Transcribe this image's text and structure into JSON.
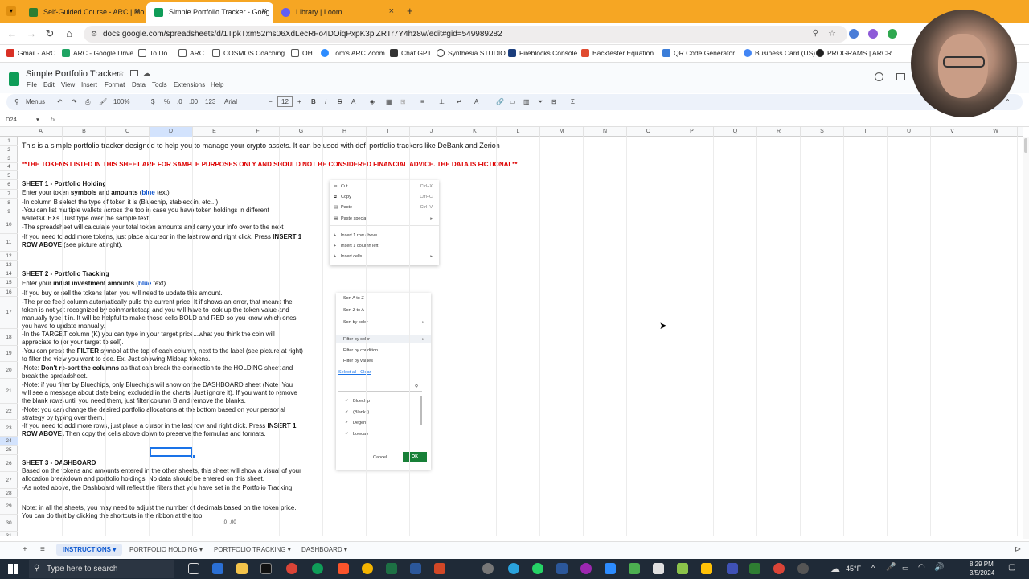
{
  "browser": {
    "tabs": [
      {
        "label": "Self-Guided Course - ARC | Mo"
      },
      {
        "label": "Simple Portfolio Tracker - Goog"
      },
      {
        "label": "Library | Loom"
      }
    ],
    "url": "docs.google.com/spreadsheets/d/1TpkTxm52ms06XdLecRFo4DOiqPxpK3plZRTr7Y4hz8w/edit#gid=549989282",
    "bookmarks": [
      "Gmail - ARC",
      "ARC - Google Drive",
      "To Do",
      "ARC",
      "COSMOS Coaching",
      "OH",
      "Tom's ARC Zoom",
      "Chat GPT",
      "Synthesia STUDIO",
      "Fireblocks Console",
      "Backtester Equation...",
      "QR Code Generator...",
      "Business Card (US)",
      "PROGRAMS | ARCR..."
    ]
  },
  "sheets": {
    "title": "Simple Portfolio Tracker",
    "menu": [
      "File",
      "Edit",
      "View",
      "Insert",
      "Format",
      "Data",
      "Tools",
      "Extensions",
      "Help"
    ],
    "toolbar": {
      "menus": "Menus",
      "zoom": "100%",
      "font": "Arial",
      "font_size": "12",
      "currency": "$",
      "percent": "%",
      "dec_less": ".0",
      "dec_more": ".00",
      "format": "123"
    },
    "namebox": "D24",
    "fx": "fx",
    "columns": [
      "A",
      "B",
      "C",
      "D",
      "E",
      "F",
      "G",
      "H",
      "I",
      "J",
      "K",
      "L",
      "M",
      "N",
      "O",
      "P",
      "Q",
      "R",
      "S",
      "T",
      "U",
      "V",
      "W"
    ],
    "rows": [
      "1",
      "2",
      "3",
      "4",
      "5",
      "6",
      "7",
      "8",
      "9",
      "10",
      "11",
      "12",
      "13",
      "14",
      "15",
      "16",
      "17",
      "18",
      "19",
      "20",
      "21",
      "22",
      "23",
      "24",
      "25",
      "26",
      "27",
      "28",
      "29",
      "30",
      "31"
    ]
  },
  "content": {
    "r1": "This is a simple portfolio tracker designed to help you to manage your crypto assets.  It can be used with defi portfolio trackers like DeBank and Zerion",
    "r3": "**THE TOKENS LISTED IN THIS SHEET ARE FOR SAMPLE PURPOSES ONLY AND SHOULD NOT BE CONSIDERED FINANCIAL ADVICE.  THE DATA IS FICTIONAL**",
    "r5": "SHEET 1 - Portfolio Holding",
    "r6a": "Enter your token ",
    "r6b": "symbols",
    "r6c": " and ",
    "r6d": "amounts",
    "r6e": " (",
    "r6f": "blue",
    "r6g": " text)",
    "r7": "-In column B select the type of token it is (Bluechip, stablecoin, etc...)",
    "r8a": "-You can list multiple wallets across the top in case you have token holdings in different",
    "r8b": "wallets/CEXs.  Just type over the sample text",
    "r9": "-The spreadsheet will calculate your total token amounts and carry your info over to the next",
    "r10a": "-If you need to add more tokens, just place a cursor in the last row and right click.  Press ",
    "r10b": "INSERT 1",
    "r10c": "ROW ABOVE",
    "r10d": " (see picture at right).",
    "r13": "SHEET 2 - Portfolio Tracking",
    "r14a": "Enter your ",
    "r14b": "initial investment amounts",
    "r14c": " (",
    "r14d": "blue",
    "r14e": " text)",
    "r15": "-If you buy or sell the tokens later, you will need to update this amount.",
    "r16a": "-The price feed column automatically pulls the current price.  It if shows an error, that means the",
    "r16b": "token is not yet recognized by coinmarketcap and you will have to look up the token value and",
    "r16c": "manually type it in.  It will be helpful to make those cells BOLD and RED so you know which ones",
    "r16d": "you have to update manually.",
    "r17a": "-In the TARGET column (K) you can type in your target price...what you think the coin will",
    "r17b": "appreciate to (or your target to sell).",
    "r18a": "-You can press the ",
    "r18b": "FILTER",
    "r18c": " symbol at the top of each column, next to the label (see picture at right)",
    "r18d": "to filter the view you want to see.  Ex. Just showing Midcap tokens.",
    "r19a": "-Note:  ",
    "r19b": "Don't re-sort the columns",
    "r19c": " as that can break the connection to the HOLDING sheet and",
    "r19d": "break the spreadsheet.",
    "r20a": "-Note:  if you filter by Bluechips, only Bluechips will show on the DASHBOARD sheet (Note:  You",
    "r20b": "will see a message about date being excluded in the charts.  Just ignore it).  If you want to remove",
    "r20c": "the blank rows until you need them, just filter column B and remove the blanks.",
    "r21a": "-Note:  you can change the desired portfolio allocations at the bottom based on your personal",
    "r21b": "strategy by typing over them.",
    "r22a": "-If you need to add more rows, just place a cursor in the last row and right click.  Press ",
    "r22b": "INSERT 1",
    "r22c": "ROW ABOVE.",
    "r22d": "  Then copy the cells above down to preserve the formulas and formats.",
    "r25": "SHEET 3  - DASHBOARD",
    "r26a": "Based on the tokens and amounts entered in the other sheets, this sheet will show a visual of your",
    "r26b": "allocation breakdown and portfolio holdings.  No data should be entered on this sheet.",
    "r27": "-As noted above, the Dashboard will reflect the filters that you have set in the Portfolio Tracking",
    "r29a": "Note:  in all the sheets, you may need to adjust the number of decimals based on the token price.",
    "r29b": "You can do that by clicking the shortcuts in the ribbon at the top."
  },
  "ctxmenu": {
    "items": [
      "Cut",
      "Copy",
      "Paste",
      "Paste special",
      "Insert 1 row above",
      "Insert 1 column left",
      "Insert cells"
    ],
    "shortcuts": [
      "Ctrl+X",
      "Ctrl+C",
      "Ctrl+V"
    ]
  },
  "filtermenu": {
    "items": [
      "Sort A to Z",
      "Sort Z to A",
      "Sort by color",
      "Filter by color",
      "Filter by condition",
      "Filter by values"
    ],
    "select": "Select all - Clear",
    "values": [
      "Bluechip",
      "(Blanks)",
      "Degen",
      "Lowcap"
    ],
    "cancel": "Cancel",
    "ok": "OK"
  },
  "decimals_img": ".0  .00",
  "sheettabs": [
    "INSTRUCTIONS",
    "PORTFOLIO HOLDING",
    "PORTFOLIO TRACKING",
    "DASHBOARD"
  ],
  "taskbar": {
    "search": "Type here to search",
    "weather": "45°F",
    "time": "8:29 PM",
    "date": "3/5/2024"
  }
}
